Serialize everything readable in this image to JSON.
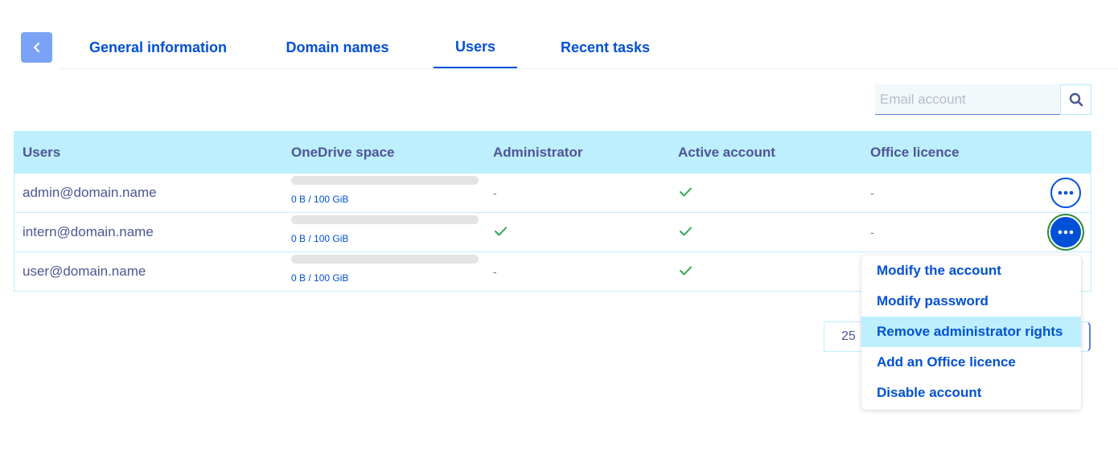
{
  "tabs": [
    {
      "label": "General information"
    },
    {
      "label": "Domain names"
    },
    {
      "label": "Users"
    },
    {
      "label": "Recent tasks"
    }
  ],
  "active_tab": "Users",
  "search": {
    "placeholder": "Email account",
    "value": ""
  },
  "table": {
    "headers": [
      "Users",
      "OneDrive space",
      "Administrator",
      "Active account",
      "Office licence"
    ],
    "rows": [
      {
        "user": "admin@domain.name",
        "space": "0 B / 100 GiB",
        "space_used_fraction": 0,
        "administrator": "-",
        "administrator_checked": false,
        "active": true,
        "office_licence": "-"
      },
      {
        "user": "intern@domain.name",
        "space": "0 B / 100 GiB",
        "space_used_fraction": 0,
        "administrator": "",
        "administrator_checked": true,
        "active": true,
        "office_licence": "-"
      },
      {
        "user": "user@domain.name",
        "space": "0 B / 100 GiB",
        "space_used_fraction": 0,
        "administrator": "-",
        "administrator_checked": false,
        "active": true,
        "office_licence": ""
      }
    ]
  },
  "pagination": {
    "page_size": "25"
  },
  "context_menu": {
    "items": [
      {
        "label": "Modify the account"
      },
      {
        "label": "Modify password"
      },
      {
        "label": "Remove administrator rights"
      },
      {
        "label": "Add an Office licence"
      },
      {
        "label": "Disable account"
      }
    ],
    "highlighted_index": 2
  },
  "colors": {
    "accent": "#0050d7",
    "header_bg": "#bdefff",
    "text": "#4d5592",
    "check": "#2fa84f",
    "back_button": "#7ba3f5"
  },
  "icons": [
    "chevron-left-icon",
    "search-icon",
    "check-icon",
    "more-horizontal-icon"
  ]
}
